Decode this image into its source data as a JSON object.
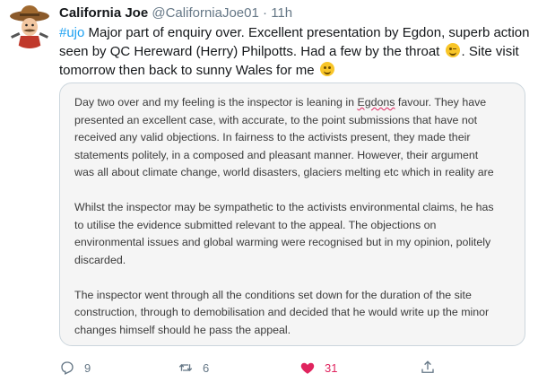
{
  "tweet": {
    "display_name": "California Joe",
    "handle": "@CaliforniaJoe01",
    "separator": "·",
    "time": "11h",
    "hashtag": "#ujo",
    "text_part1": " Major part of enquiry over. Excellent presentation by Egdon, superb action seen by QC Hereward (Herry) Philpotts. Had a few by the throat ",
    "text_part2": ". Site visit tomorrow then back to sunny Wales for me ",
    "emoji_1": "winking-face",
    "emoji_2": "smiling-face"
  },
  "note_image": {
    "paragraph1_a": "Day two over and my feeling is the inspector is leaning in ",
    "paragraph1_misspelled": "Egdons",
    "paragraph1_b": " favour. They have presented an excellent case, with accurate, to the point submissions that have not received any valid objections. In fairness to the activists present, they made their statements politely, in a composed and pleasant manner. However, their argument was all about climate change, world disasters, glaciers melting etc which in reality are",
    "paragraph2": "Whilst the inspector may be sympathetic to the activists environmental claims, he has to utilise the evidence submitted relevant to the appeal. The objections on environmental issues and global warming were recognised but in my opinion, politely discarded.",
    "paragraph3": "The inspector went through all the conditions set down for the duration of the site construction, through to demobilisation and decided that he would write up the minor changes himself should he pass the appeal."
  },
  "actions": {
    "reply_count": "9",
    "retweet_count": "6",
    "like_count": "31",
    "share_label": ""
  },
  "colors": {
    "link": "#1da1f2",
    "muted": "#657786",
    "like": "#e0245e"
  }
}
